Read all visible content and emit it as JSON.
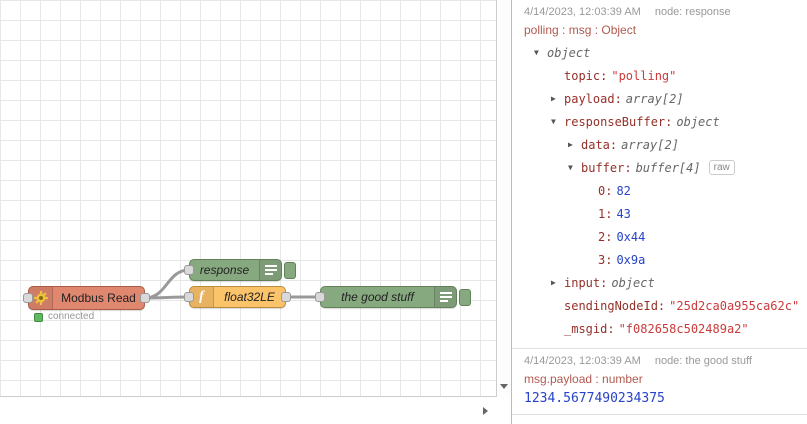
{
  "colors": {
    "modbus_node": "#e0876f",
    "debug_node": "#87a980",
    "function_node": "#fbc36a",
    "wire": "#999999",
    "status_ok": "#61b861",
    "debug_key": "#943029",
    "debug_string": "#cb3b3b",
    "debug_number": "#2743c7",
    "debug_path": "#b15a50"
  },
  "canvas": {
    "nodes": {
      "modbus": {
        "label": "Modbus Read",
        "status": "connected",
        "icon": "gear-icon"
      },
      "response": {
        "label": "response",
        "icon": "debug-list-icon"
      },
      "func": {
        "label": "float32LE",
        "icon": "function-f-icon",
        "icon_glyph": "f"
      },
      "goodstuff": {
        "label": "the good stuff",
        "icon": "debug-list-icon"
      }
    }
  },
  "debug": {
    "raw_label": "raw",
    "messages": [
      {
        "timestamp": "4/14/2023, 12:03:39 AM",
        "node": "node: response",
        "path": "polling : msg : Object",
        "tree": [
          {
            "indent": 0,
            "caret": "open",
            "key": null,
            "value": "object",
            "cls": "type"
          },
          {
            "indent": 1,
            "caret": null,
            "key": "topic",
            "value": "\"polling\"",
            "cls": "string"
          },
          {
            "indent": 1,
            "caret": "closed",
            "key": "payload",
            "value": "array[2]",
            "cls": "type"
          },
          {
            "indent": 1,
            "caret": "open",
            "key": "responseBuffer",
            "value": "object",
            "cls": "type"
          },
          {
            "indent": 2,
            "caret": "closed",
            "key": "data",
            "value": "array[2]",
            "cls": "type"
          },
          {
            "indent": 2,
            "caret": "open",
            "key": "buffer",
            "value": "buffer[4]",
            "cls": "type",
            "raw": true
          },
          {
            "indent": 3,
            "caret": null,
            "key": "0",
            "value": "82",
            "cls": "number"
          },
          {
            "indent": 3,
            "caret": null,
            "key": "1",
            "value": "43",
            "cls": "number"
          },
          {
            "indent": 3,
            "caret": null,
            "key": "2",
            "value": "0x44",
            "cls": "number"
          },
          {
            "indent": 3,
            "caret": null,
            "key": "3",
            "value": "0x9a",
            "cls": "number"
          },
          {
            "indent": 1,
            "caret": "closed",
            "key": "input",
            "value": "object",
            "cls": "type"
          },
          {
            "indent": 1,
            "caret": null,
            "key": "sendingNodeId",
            "value": "\"25d2ca0a955ca62c\"",
            "cls": "string"
          },
          {
            "indent": 1,
            "caret": null,
            "key": "_msgid",
            "value": "\"f082658c502489a2\"",
            "cls": "string"
          }
        ]
      },
      {
        "timestamp": "4/14/2023, 12:03:39 AM",
        "node": "node: the good stuff",
        "path": "msg.payload : number",
        "value": "1234.5677490234375"
      }
    ]
  }
}
